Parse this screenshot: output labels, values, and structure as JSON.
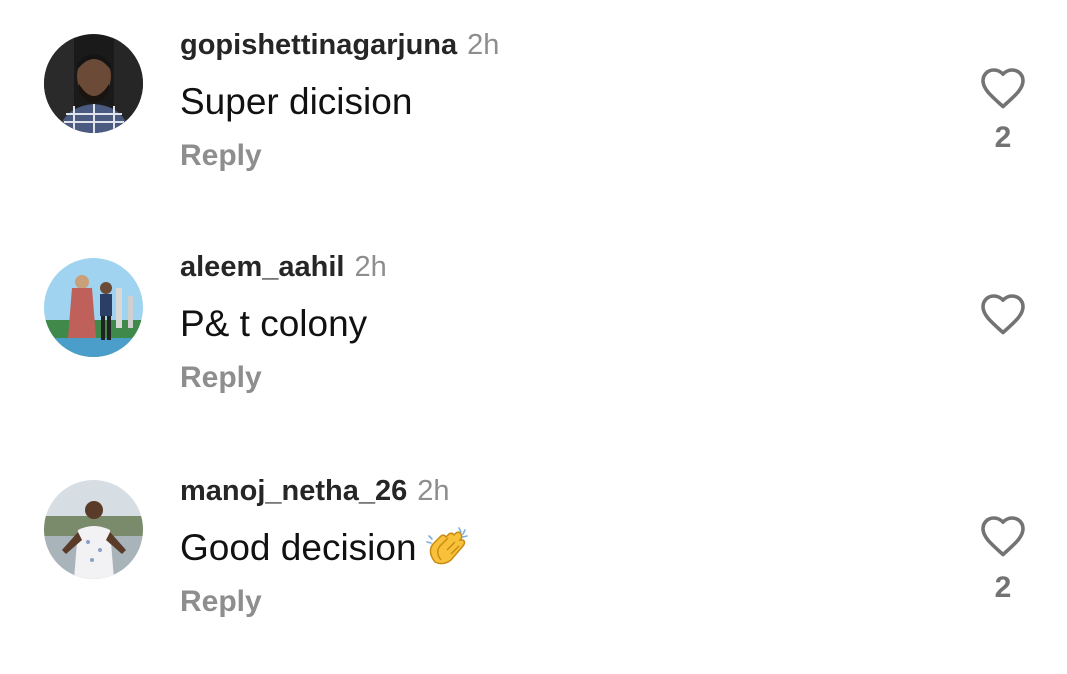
{
  "comments": [
    {
      "username": "gopishettinagarjuna",
      "time": "2h",
      "text": "Super dicision",
      "reply_label": "Reply",
      "like_count": "2",
      "avatar_icon": "profile-photo-man-beard"
    },
    {
      "username": "aleem_aahil",
      "time": "2h",
      "text": "P& t colony",
      "reply_label": "Reply",
      "like_count": "",
      "avatar_icon": "profile-photo-two-people-outdoors"
    },
    {
      "username": "manoj_netha_26",
      "time": "2h",
      "text": "Good decision",
      "emoji": "clapping-hands",
      "reply_label": "Reply",
      "like_count": "2",
      "avatar_icon": "profile-photo-man-riverside"
    }
  ],
  "colors": {
    "username": "#262626",
    "muted": "#8e8e8e",
    "text": "#111111",
    "heart_outline": "#737373"
  }
}
